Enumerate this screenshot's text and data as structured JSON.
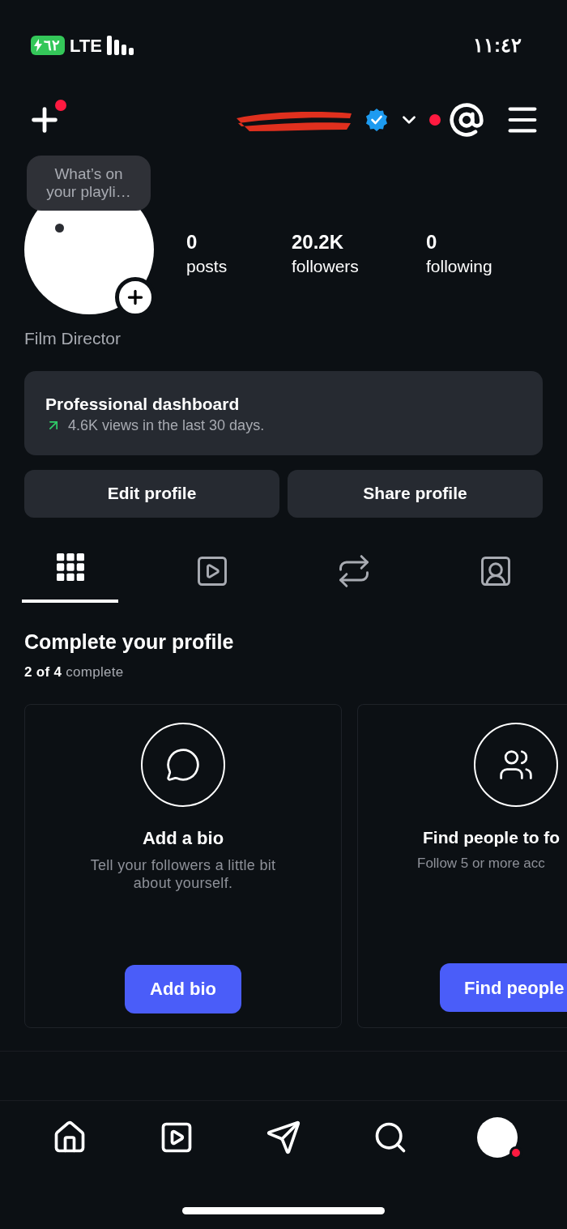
{
  "status_bar": {
    "battery": "٦٢",
    "network": "LTE",
    "time": "١١:٤٢"
  },
  "header": {
    "new_post_notification": true,
    "verified": true,
    "account_notification": true
  },
  "profile": {
    "note": "What’s on your playli…",
    "stats": [
      {
        "value": "0",
        "label": "posts"
      },
      {
        "value": "20.2K",
        "label": "followers"
      },
      {
        "value": "0",
        "label": "following"
      }
    ],
    "category": "Film Director"
  },
  "dashboard": {
    "title": "Professional dashboard",
    "summary": "4.6K views in the last 30 days."
  },
  "actions": [
    "Edit profile",
    "Share profile"
  ],
  "tabs": [
    {
      "kind": "grid",
      "selected": true
    },
    {
      "kind": "reels",
      "selected": false
    },
    {
      "kind": "reposts",
      "selected": false
    },
    {
      "kind": "tagged",
      "selected": false
    }
  ],
  "complete_profile": {
    "title": "Complete your profile",
    "progress": "**2 of 4** complete",
    "cards": [
      {
        "kind": "bio",
        "title": "Add a bio",
        "description": "Tell your followers a little bit about yourself.",
        "button": "Add bio"
      },
      {
        "kind": "people",
        "title": "Find people to fo",
        "description": "Follow 5 or more acc",
        "button": "Find people"
      }
    ]
  },
  "nav": [
    {
      "kind": "home"
    },
    {
      "kind": "reels"
    },
    {
      "kind": "messages"
    },
    {
      "kind": "search"
    },
    {
      "kind": "profile",
      "notification": true
    }
  ]
}
